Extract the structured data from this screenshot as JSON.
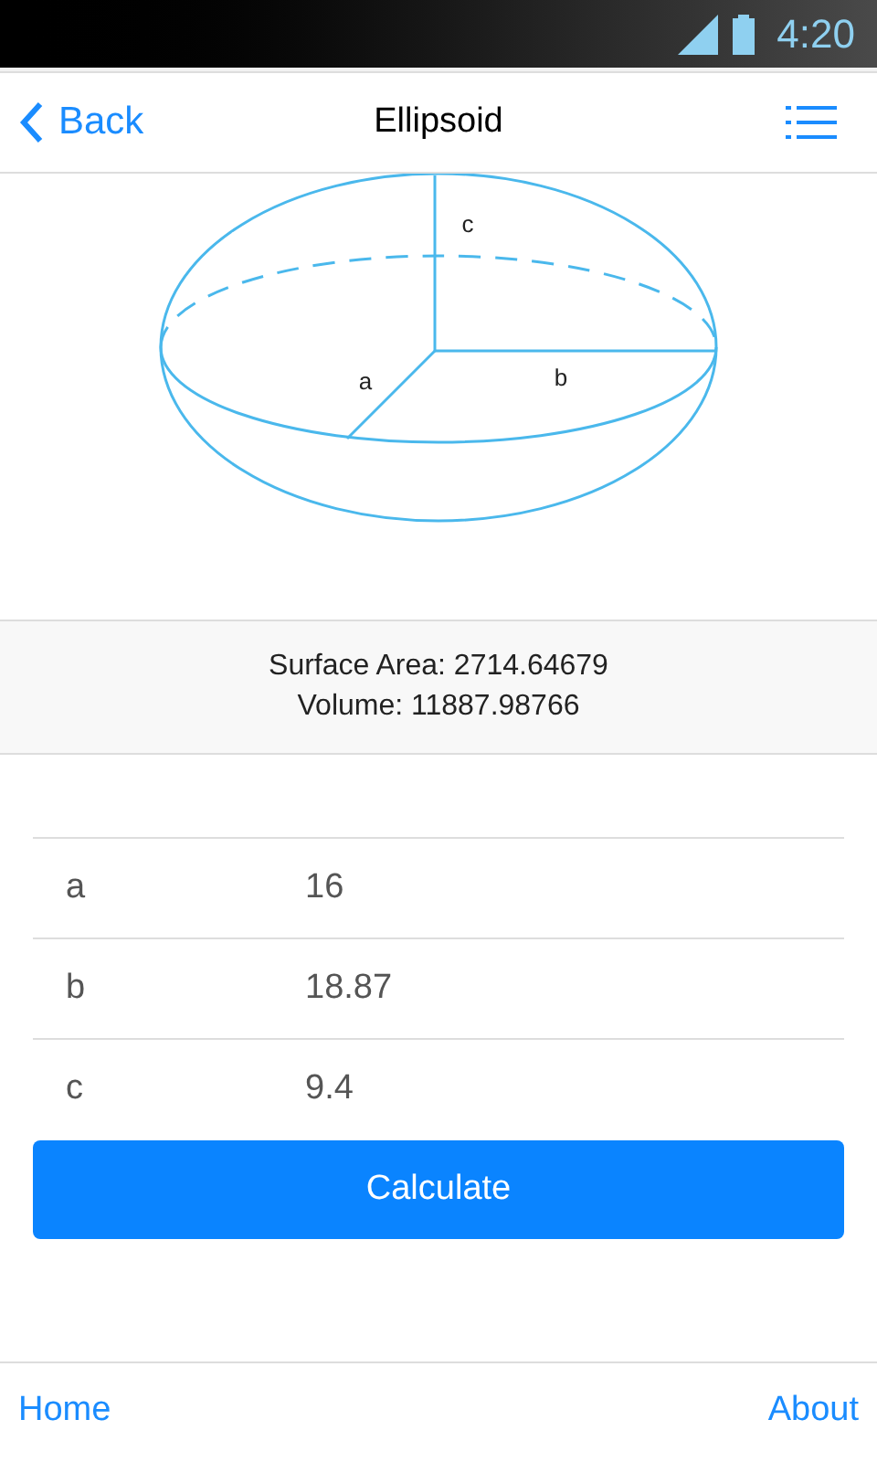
{
  "status_bar": {
    "time": "4:20"
  },
  "nav": {
    "back": "Back",
    "title": "Ellipsoid"
  },
  "diagram": {
    "labels": [
      "c",
      "a",
      "b"
    ]
  },
  "results": [
    "Surface Area: 2714.64679",
    "Volume: 11887.98766"
  ],
  "fields": [
    {
      "label": "a",
      "value": "16"
    },
    {
      "label": "b",
      "value": "18.87"
    },
    {
      "label": "c",
      "value": "9.4"
    }
  ],
  "button": "Calculate",
  "footer": {
    "left": "Home",
    "right": "About"
  }
}
